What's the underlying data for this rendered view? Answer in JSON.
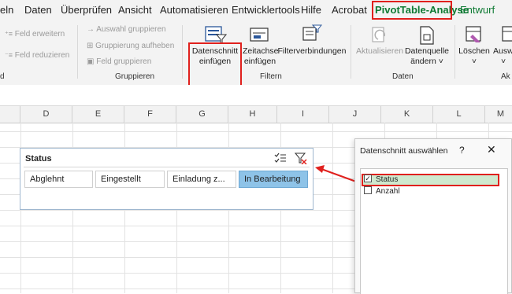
{
  "menu": {
    "tabs": [
      "eln",
      "Daten",
      "Überprüfen",
      "Ansicht",
      "Automatisieren",
      "Entwicklertools",
      "Hilfe",
      "Acrobat",
      "PivotTable-Analyse",
      "Entwurf"
    ],
    "active_tab": "PivotTable-Analyse"
  },
  "ribbon": {
    "field_group": {
      "expand": "Feld erweitern",
      "collapse": "Feld reduzieren",
      "label": "d"
    },
    "group_group": {
      "group_selection": "Auswahl gruppieren",
      "ungroup": "Gruppierung aufheben",
      "group_field": "Feld gruppieren",
      "label": "Gruppieren"
    },
    "filter_group": {
      "insert_slicer_1": "Datenschnitt",
      "insert_slicer_2": "einfügen",
      "insert_timeline_1": "Zeitachse",
      "insert_timeline_2": "einfügen",
      "filter_connections": "Filterverbindungen",
      "label": "Filtern"
    },
    "data_group": {
      "refresh": "Aktualisieren",
      "change_source_1": "Datenquelle",
      "change_source_2": "ändern ˅",
      "label": "Daten"
    },
    "actions_group": {
      "clear": "Löschen",
      "select": "Auswa",
      "label": "Ak"
    }
  },
  "columns": [
    "D",
    "E",
    "F",
    "G",
    "H",
    "I",
    "J",
    "K",
    "L",
    "M"
  ],
  "slicer": {
    "title": "Status",
    "items": [
      "Abglehnt",
      "Eingestellt",
      "Einladung z...",
      "In Bearbeitung"
    ],
    "selected": "In Bearbeitung"
  },
  "dialog": {
    "title": "Datenschnitt auswählen",
    "help": "?",
    "close": "✕",
    "fields": [
      {
        "label": "Status",
        "checked": true
      },
      {
        "label": "Anzahl",
        "checked": false
      }
    ]
  },
  "colors": {
    "active_tab": "#0e7a33",
    "highlight": "#e0201d",
    "slicer_selected": "#8ec3e8"
  }
}
